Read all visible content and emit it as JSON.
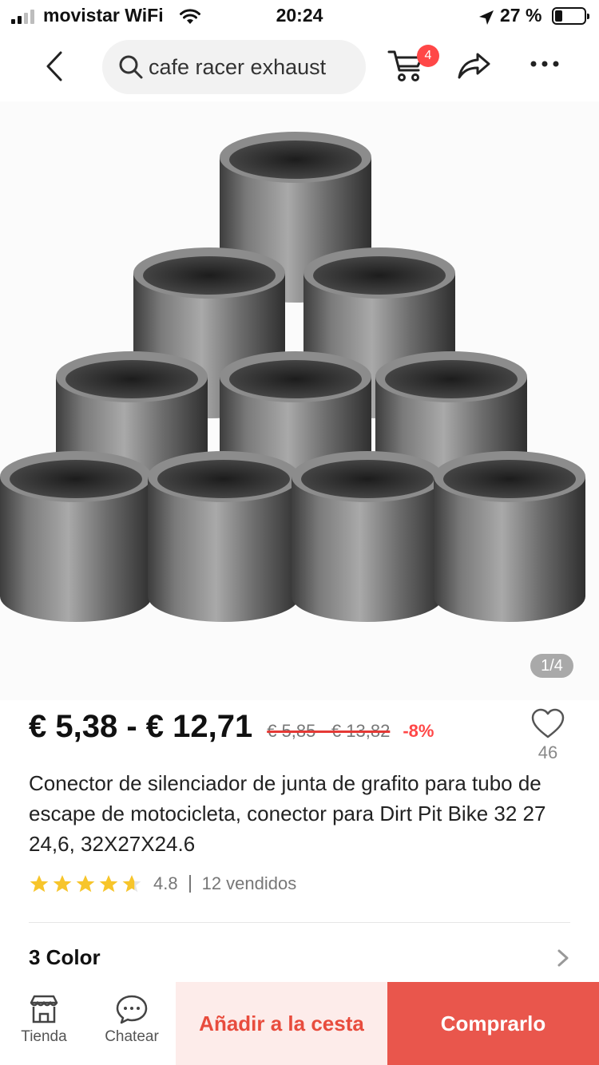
{
  "status_bar": {
    "carrier": "movistar WiFi",
    "time": "20:24",
    "battery_percent": "27 %",
    "battery_level": 0.27
  },
  "nav": {
    "search_query": "cafe racer exhaust",
    "cart_count": "4",
    "icons": [
      "back-arrow-icon",
      "search-icon",
      "cart-icon",
      "share-icon",
      "more-icon"
    ]
  },
  "gallery": {
    "counter": "1/4"
  },
  "product": {
    "price_range": "€ 5,38 - € 12,71",
    "original_price": "€ 5,85 - € 13,82",
    "discount": "-8%",
    "wishlist_count": "46",
    "title": "Conector de silenciador de junta de grafito para tubo de escape de motocicleta, conector para Dirt Pit Bike 32 27 24,6, 32X27X24.6",
    "rating": "4.8",
    "rating_value": 4.8,
    "sold": "12 vendidos",
    "color_option": "3 Color"
  },
  "bottom_bar": {
    "store_label": "Tienda",
    "chat_label": "Chatear",
    "add_to_cart": "Añadir a la cesta",
    "buy_now": "Comprarlo"
  },
  "colors": {
    "accent": "#ff4747",
    "buy_button": "#e9564c",
    "add_button_bg": "#fdecea",
    "star": "#f7c52b"
  }
}
